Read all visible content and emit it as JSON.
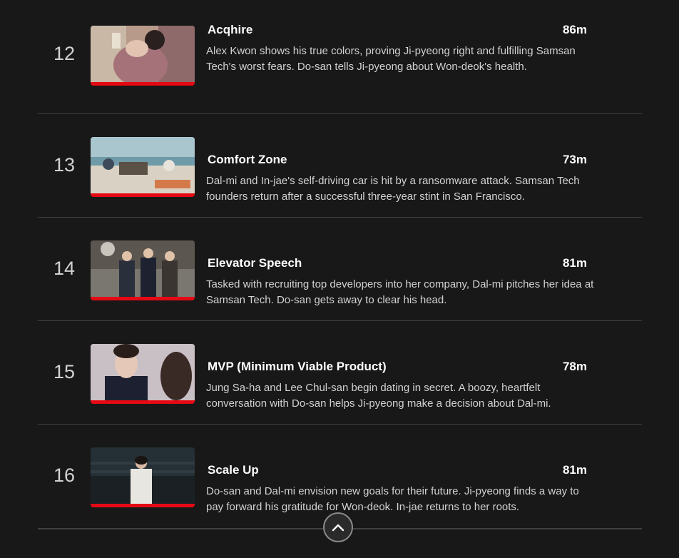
{
  "episodes": [
    {
      "index": "12",
      "title": "Acqhire",
      "duration": "86m",
      "description": "Alex Kwon shows his true colors, proving Ji-pyeong right and fulfilling Samsan Tech's worst fears. Do-san tells Ji-pyeong about Won-deok's health.",
      "progress_fraction": 1.0
    },
    {
      "index": "13",
      "title": "Comfort Zone",
      "duration": "73m",
      "description": "Dal-mi and In-jae's self-driving car is hit by a ransomware attack. Samsan Tech founders return after a successful three-year stint in San Francisco.",
      "progress_fraction": 1.0
    },
    {
      "index": "14",
      "title": "Elevator Speech",
      "duration": "81m",
      "description": "Tasked with recruiting top developers into her company, Dal-mi pitches her idea at Samsan Tech. Do-san gets away to clear his head.",
      "progress_fraction": 1.0
    },
    {
      "index": "15",
      "title": "MVP (Minimum Viable Product)",
      "duration": "78m",
      "description": "Jung Sa-ha and Lee Chul-san begin dating in secret. A boozy, heartfelt conversation with Do-san helps Ji-pyeong make a decision about Dal-mi.",
      "progress_fraction": 1.0
    },
    {
      "index": "16",
      "title": "Scale Up",
      "duration": "81m",
      "description": "Do-san and Dal-mi envision new goals for their future. Ji-pyeong finds a way to pay forward his gratitude for Won-deok. In-jae returns to her roots.",
      "progress_fraction": 1.0
    }
  ],
  "colors": {
    "background": "#181818",
    "progress": "#e50914",
    "divider": "#404040"
  },
  "collapse_icon": "chevron-up-icon"
}
